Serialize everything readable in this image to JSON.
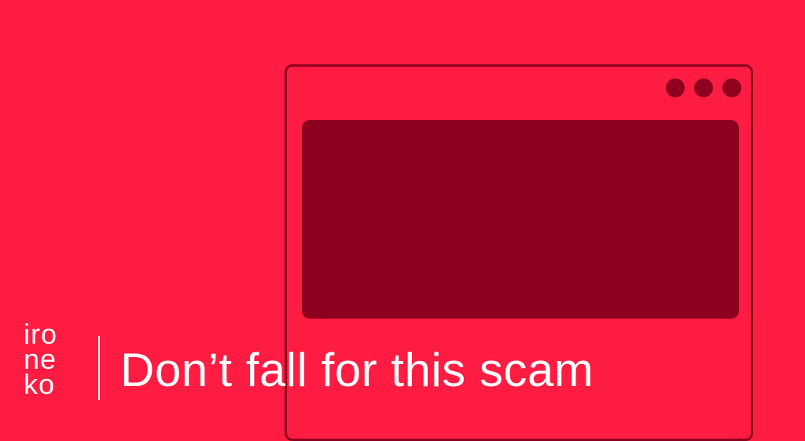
{
  "brand": {
    "logo_lines": [
      "iro",
      "ne",
      "ko"
    ]
  },
  "headline": "Don’t fall for this scam",
  "colors": {
    "background": "#ff1c42",
    "window_stroke": "#8d001e",
    "screen_fill": "#8d001e",
    "text": "#ffffff"
  },
  "icons": {
    "window_controls": [
      "circle-icon",
      "circle-icon",
      "circle-icon"
    ]
  }
}
